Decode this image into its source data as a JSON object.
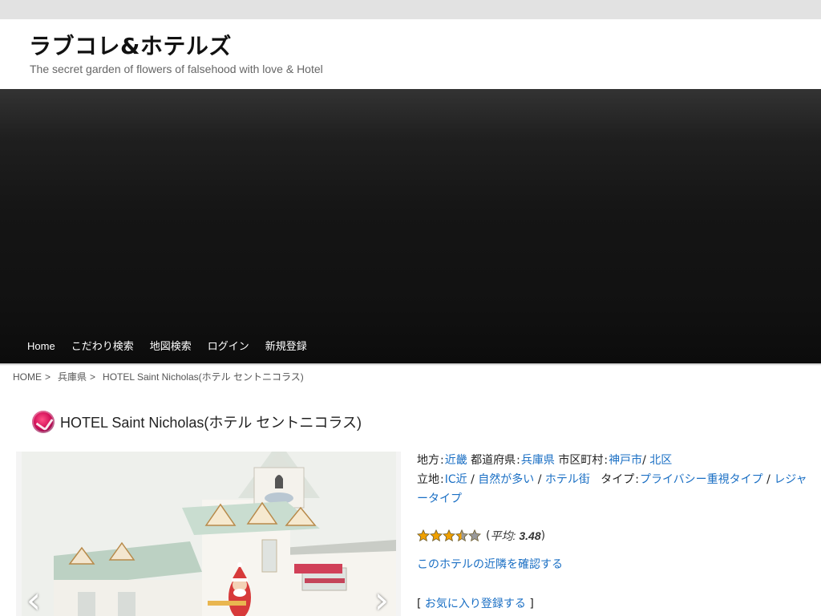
{
  "site": {
    "title": "ラブコレ&ホテルズ",
    "description": "The secret garden of flowers of falsehood with love & Hotel"
  },
  "nav": {
    "items": [
      "Home",
      "こだわり検索",
      "地図検索",
      "ログイン",
      "新規登録"
    ]
  },
  "breadcrumb": {
    "home": "HOME",
    "separator": ">",
    "prefecture": "兵庫県",
    "current": "HOTEL Saint Nicholas(ホテル セントニコラス)"
  },
  "hotel": {
    "name": "HOTEL Saint Nicholas(ホテル セントニコラス)",
    "region_label": "地方",
    "region": "近畿",
    "prefecture_label": "都道府県",
    "prefecture": "兵庫県",
    "city_label": "市区町村",
    "city": "神戸市",
    "ward": "北区",
    "location_label": "立地",
    "location_tags": [
      "IC近",
      "自然が多い",
      "ホテル街"
    ],
    "type_label": "タイプ",
    "type_tags": [
      "プライバシー重視タイプ",
      "レジャータイプ"
    ],
    "colon": ":",
    "slash": "/"
  },
  "rating": {
    "value": 3.48,
    "max": 5,
    "open_paren": "(",
    "avg_label": "平均:",
    "avg_value": "3.48",
    "close_paren": ")"
  },
  "links": {
    "nearby": "このホテルの近隣を確認する",
    "favorite_open": "[",
    "favorite": "お気に入り登録する",
    "favorite_close": "]"
  },
  "slider": {
    "prev_icon": "chevron-left-icon",
    "next_icon": "chevron-right-icon",
    "prev_glyph": "‹",
    "next_glyph": "›"
  },
  "colors": {
    "link": "#1a6fc4",
    "header_band": "#111111",
    "star_filled": "#f0a000",
    "star_empty": "#9a9a9a"
  }
}
